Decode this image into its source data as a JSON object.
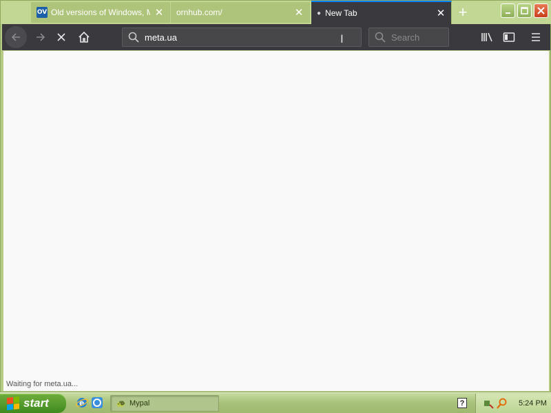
{
  "tabs": [
    {
      "title": "Old versions of Windows, Ma",
      "favicon": "OV",
      "active": false
    },
    {
      "title": "ornhub.com/",
      "active": false
    },
    {
      "title": "New Tab",
      "active": true
    }
  ],
  "toolbar": {
    "url": "meta.ua",
    "search_placeholder": "Search"
  },
  "status": "Waiting for meta.ua...",
  "taskbar": {
    "start_label": "start",
    "task_label": "Mypal",
    "clock": "5:24 PM",
    "help_glyph": "?"
  },
  "colors": {
    "frame": "#b7cd86",
    "toolbar": "#3a3a3e",
    "active_tab_accent": "#0a84ff",
    "content_bg": "#f9f9fa"
  },
  "icons": [
    "back-arrow-icon",
    "forward-arrow-icon",
    "stop-icon",
    "home-icon",
    "search-icon",
    "library-icon",
    "sidebar-icon",
    "hamburger-menu-icon",
    "close-icon",
    "plus-icon",
    "windows-logo-icon",
    "ie-icon",
    "help-icon",
    "network-icon",
    "magnifier-tray-icon"
  ]
}
